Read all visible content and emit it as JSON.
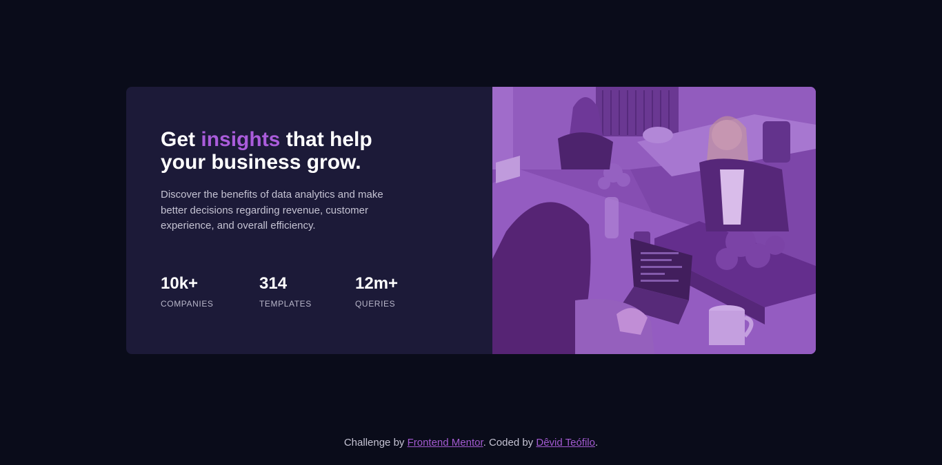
{
  "hero": {
    "headline_before": "Get ",
    "headline_accent": "insights",
    "headline_after": " that help your business grow.",
    "description": "Discover the benefits of data analytics and make better decisions regarding revenue, customer experience, and overall efficiency."
  },
  "stats": [
    {
      "value": "10k+",
      "label": "COMPANIES"
    },
    {
      "value": "314",
      "label": "TEMPLATES"
    },
    {
      "value": "12m+",
      "label": "QUERIES"
    }
  ],
  "image": {
    "icon": "office-photo",
    "tint": "#aa5cdb"
  },
  "colors": {
    "background": "#0a0c1a",
    "card": "#1c1a38",
    "accent": "#aa5cdb"
  },
  "footer": {
    "prefix": "Challenge by ",
    "link1": "Frontend Mentor",
    "middle": ". Coded by ",
    "link2": "Dêvid Teófilo",
    "suffix": "."
  }
}
